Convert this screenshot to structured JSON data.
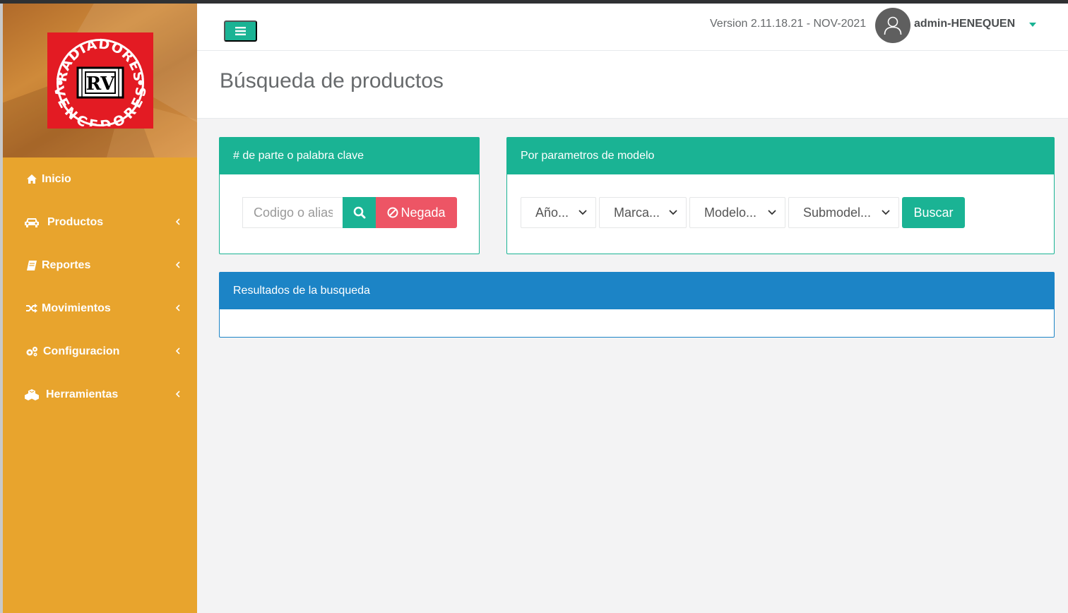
{
  "app": {
    "logo_name": "radiadores-vencedores-logo",
    "logo_text_top": "RADIADORES",
    "logo_text_bottom": "VENCEDORES",
    "logo_initials": "RV",
    "version": "Version 2.11.18.21 - NOV-2021",
    "username": "admin-HENEQUEN"
  },
  "sidebar": {
    "items": [
      {
        "label": "Inicio",
        "icon": "home-icon",
        "has_submenu": false
      },
      {
        "label": "Productos",
        "icon": "car-icon",
        "has_submenu": true
      },
      {
        "label": "Reportes",
        "icon": "book-icon",
        "has_submenu": true
      },
      {
        "label": "Movimientos",
        "icon": "random-icon",
        "has_submenu": true
      },
      {
        "label": "Configuracion",
        "icon": "cogs-icon",
        "has_submenu": true
      },
      {
        "label": "Herramientas",
        "icon": "cubes-icon",
        "has_submenu": true
      }
    ]
  },
  "page": {
    "title": "Búsqueda de productos"
  },
  "keyword_panel": {
    "title": "# de parte o palabra clave",
    "input_placeholder": "Codigo o alias",
    "input_value": "",
    "negada_label": "Negada"
  },
  "model_panel": {
    "title": "Por parametros de modelo",
    "year_select": "Año...",
    "brand_select": "Marca...",
    "model_select": "Modelo...",
    "submodel_select": "Submodel...",
    "search_label": "Buscar"
  },
  "results_panel": {
    "title": "Resultados de la busqueda"
  },
  "colors": {
    "primary": "#1ab394",
    "danger": "#ed5565",
    "info": "#1c84c6",
    "sidebar": "#e8a42d",
    "logo_red": "#e31b23"
  }
}
